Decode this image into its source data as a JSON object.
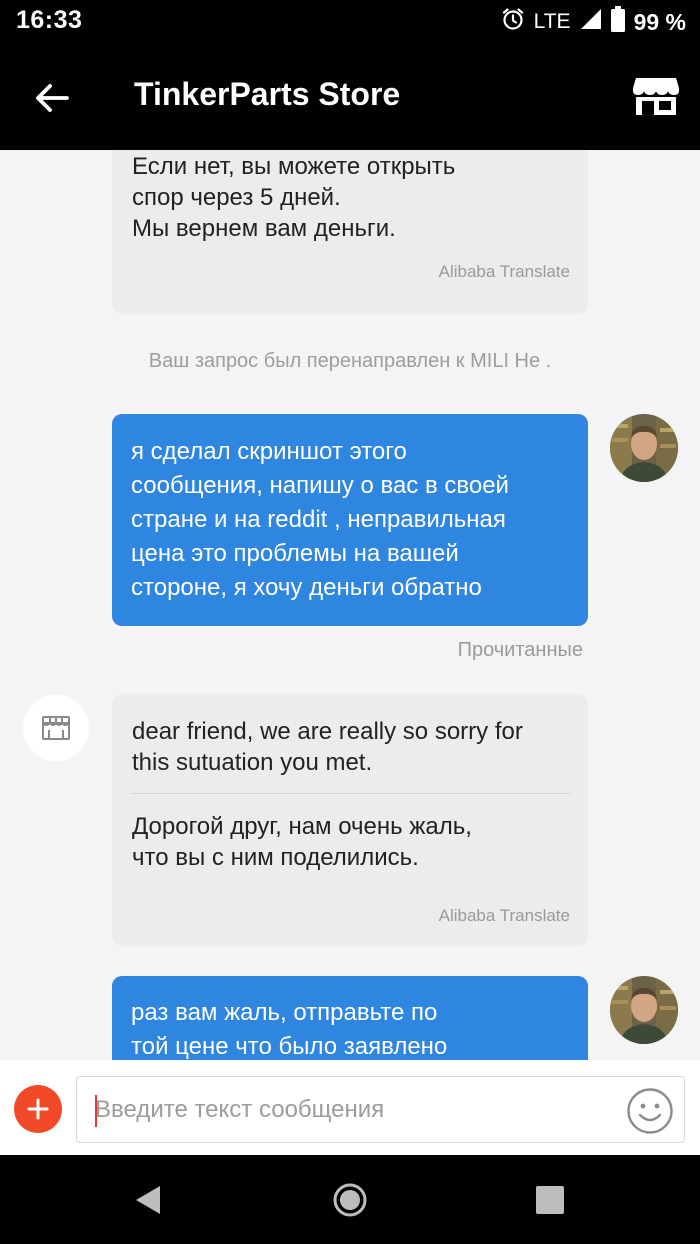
{
  "status_bar": {
    "time": "16:33",
    "network": "LTE",
    "battery": "99 %"
  },
  "app_bar": {
    "title": "TinkerParts Store"
  },
  "messages": {
    "m1": {
      "text": "Если нет, вы можете открыть\nспор через 5 дней.\nМы вернем вам деньги.",
      "translate_label": "Alibaba Translate"
    },
    "system_note": "Ваш запрос был перенаправлен к MILI He .",
    "m2": {
      "text": "я сделал скриншот этого\nсообщения, напишу о вас в своей\nстране и на reddit , неправильная\nцена это проблемы на вашей\nстороне, я хочу деньги обратно",
      "status": "Прочитанные"
    },
    "m3": {
      "original": "dear friend, we are really so sorry for\nthis sutuation you met.",
      "translated": "Дорогой друг, нам очень жаль,\nчто вы с ним поделились.",
      "translate_label": "Alibaba Translate"
    },
    "m4": {
      "text": "раз вам жаль, отправьте по\nтой цене что было заявлено"
    }
  },
  "input": {
    "placeholder": "Введите текст сообщения"
  },
  "colors": {
    "outgoing_bubble": "#2f86e0",
    "incoming_bubble": "#ececec",
    "add_button": "#f24a28",
    "bars": "#000000"
  },
  "icons": {
    "back": "arrow-left-icon",
    "store": "store-icon",
    "add": "plus-icon",
    "emoji": "smiley-icon",
    "alarm": "alarm-icon",
    "signal": "signal-icon",
    "battery": "battery-icon"
  }
}
